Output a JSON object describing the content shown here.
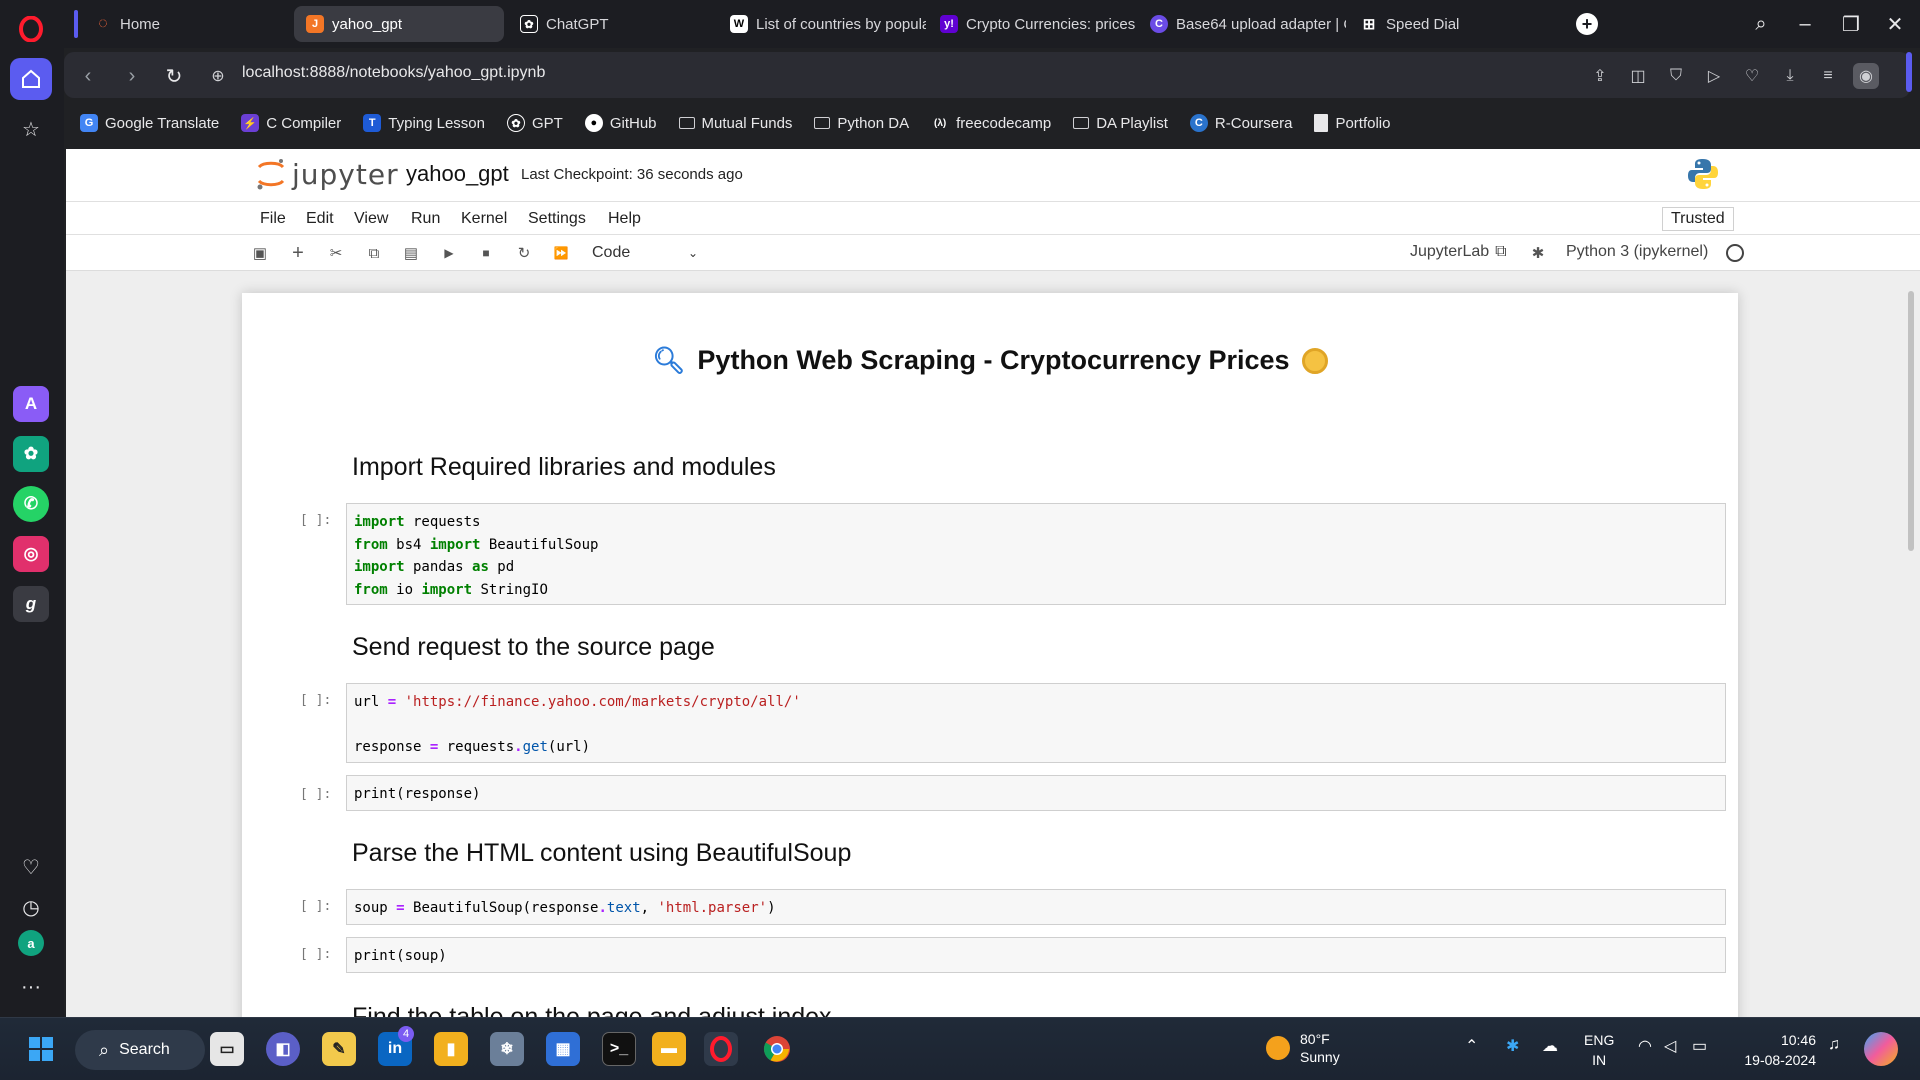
{
  "browser": {
    "tabs": [
      {
        "label": "Home",
        "icon": "opera-icon"
      },
      {
        "label": "yahoo_gpt",
        "icon": "jupyter-icon",
        "active": true
      },
      {
        "label": "ChatGPT",
        "icon": "chatgpt-icon"
      },
      {
        "label": "List of countries by popula",
        "icon": "wikipedia-icon"
      },
      {
        "label": "Crypto Currencies: prices,",
        "icon": "yahoo-icon"
      },
      {
        "label": "Base64 upload adapter | C",
        "icon": "ckeditor-icon"
      },
      {
        "label": "Speed Dial",
        "icon": "speed-dial-icon"
      }
    ],
    "url": "localhost:8888/notebooks/yahoo_gpt.ipynb",
    "bookmarks": [
      {
        "label": "Google Translate",
        "icon": "google-translate-icon"
      },
      {
        "label": "C Compiler",
        "icon": "bolt-icon"
      },
      {
        "label": "Typing Lesson",
        "icon": "typing-icon"
      },
      {
        "label": "GPT",
        "icon": "chatgpt-icon"
      },
      {
        "label": "GitHub",
        "icon": "github-icon"
      },
      {
        "label": "Mutual Funds",
        "icon": "folder-icon"
      },
      {
        "label": "Python DA",
        "icon": "folder-icon"
      },
      {
        "label": "freecodecamp",
        "icon": "freecodecamp-icon"
      },
      {
        "label": "DA Playlist",
        "icon": "folder-icon"
      },
      {
        "label": "R-Coursera",
        "icon": "coursera-icon"
      },
      {
        "label": "Portfolio",
        "icon": "document-icon"
      }
    ]
  },
  "jupyter": {
    "logo_text": "jupyter",
    "notebook_name": "yahoo_gpt",
    "checkpoint": "Last Checkpoint: 36 seconds ago",
    "menu": [
      "File",
      "Edit",
      "View",
      "Run",
      "Kernel",
      "Settings",
      "Help"
    ],
    "trusted": "Trusted",
    "cell_type": "Code",
    "jupyterlab_link": "JupyterLab",
    "kernel": "Python 3 (ipykernel)"
  },
  "notebook": {
    "title": "Python Web Scraping - Cryptocurrency Prices",
    "headings": [
      "Import Required libraries and modules",
      "Send request to the source page",
      "Parse the HTML content using BeautifulSoup",
      "Find the table on the page and adjust index"
    ],
    "prompt": "[ ]:",
    "cells": {
      "imports": [
        "import requests",
        "from bs4 import BeautifulSoup",
        "import pandas as pd",
        "from io import StringIO"
      ],
      "request_url": "url = 'https://finance.yahoo.com/markets/crypto/all/'",
      "request_get": "response = requests.get(url)",
      "print_response": "print(response)",
      "soup": "soup = BeautifulSoup(response.text, 'html.parser')",
      "print_soup": "print(soup)"
    }
  },
  "taskbar": {
    "search": "Search",
    "weather_temp": "80°F",
    "weather_desc": "Sunny",
    "lang_top": "ENG",
    "lang_bottom": "IN",
    "time": "10:46",
    "date": "19-08-2024",
    "badge_count": "4"
  }
}
